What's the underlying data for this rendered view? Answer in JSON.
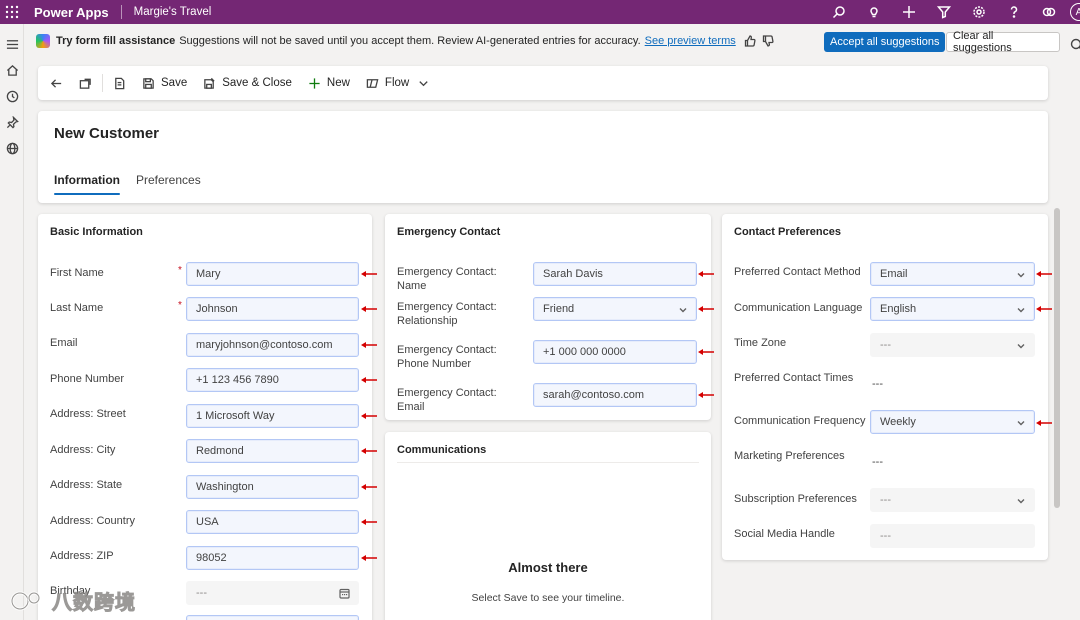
{
  "appbar": {
    "app_name": "Power Apps",
    "environment": "Margie's Travel",
    "avatar_initial": "A",
    "icons": [
      "search-icon",
      "lightbulb-icon",
      "plus-icon",
      "filter-icon",
      "gear-icon",
      "help-icon",
      "copilot-icon"
    ]
  },
  "leftrail": {
    "icons": [
      "hamburger-icon",
      "home-icon",
      "recent-icon",
      "pin-icon",
      "globe-icon"
    ]
  },
  "banner": {
    "title": "Try form fill assistance",
    "message": "Suggestions will not be saved until you accept them. Review AI-generated entries for accuracy.",
    "link": "See preview terms",
    "accept_all": "Accept all suggestions",
    "clear_all": "Clear all suggestions"
  },
  "commandbar": {
    "save": "Save",
    "save_close": "Save & Close",
    "new": "New",
    "flow": "Flow"
  },
  "record": {
    "title": "New Customer",
    "tabs": [
      "Information",
      "Preferences"
    ],
    "active_tab": "Information"
  },
  "basic_info": {
    "title": "Basic Information",
    "fields": [
      {
        "label": "First Name",
        "value": "Mary",
        "required": true
      },
      {
        "label": "Last Name",
        "value": "Johnson",
        "required": true
      },
      {
        "label": "Email",
        "value": "maryjohnson@contoso.com"
      },
      {
        "label": "Phone Number",
        "value": "+1 123 456 7890"
      },
      {
        "label": "Address: Street",
        "value": "1 Microsoft Way"
      },
      {
        "label": "Address: City",
        "value": "Redmond"
      },
      {
        "label": "Address: State",
        "value": "Washington"
      },
      {
        "label": "Address: Country",
        "value": "USA"
      },
      {
        "label": "Address: ZIP",
        "value": "98052"
      },
      {
        "label": "Birthday",
        "value": "---"
      }
    ]
  },
  "emergency": {
    "title": "Emergency Contact",
    "fields": [
      {
        "label": "Emergency Contact: Name",
        "value": "Sarah Davis"
      },
      {
        "label": "Emergency Contact: Relationship",
        "value": "Friend"
      },
      {
        "label": "Emergency Contact: Phone Number",
        "value": "+1 000 000 0000"
      },
      {
        "label": "Emergency Contact: Email",
        "value": "sarah@contoso.com"
      }
    ]
  },
  "communications": {
    "title": "Communications",
    "heading": "Almost there",
    "sub": "Select Save to see your timeline."
  },
  "contact_prefs": {
    "title": "Contact Preferences",
    "fields": [
      {
        "label": "Preferred Contact Method",
        "value": "Email"
      },
      {
        "label": "Communication Language",
        "value": "English"
      },
      {
        "label": "Time Zone",
        "value": "---"
      },
      {
        "label": "Preferred Contact Times",
        "value": "---"
      },
      {
        "label": "Communication Frequency",
        "value": "Weekly"
      },
      {
        "label": "Marketing Preferences",
        "value": "---"
      },
      {
        "label": "Subscription Preferences",
        "value": "---"
      },
      {
        "label": "Social Media Handle",
        "value": "---"
      }
    ]
  },
  "watermark": {
    "text": "八数跨境"
  },
  "colors": {
    "appbar": "#742774",
    "primary": "#0f6cbd",
    "arrow": "#d40000",
    "ai_field_border": "#b3c7f5"
  }
}
